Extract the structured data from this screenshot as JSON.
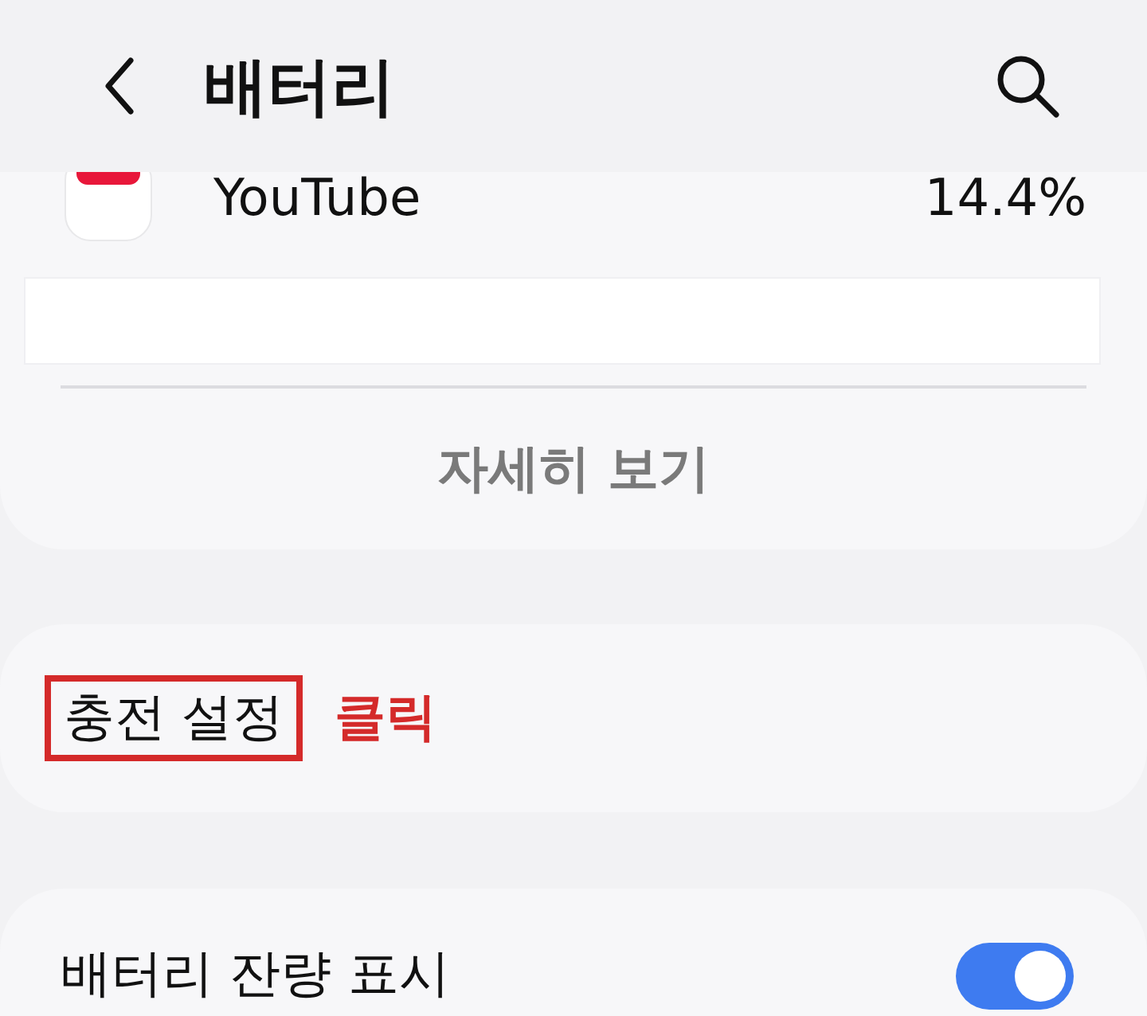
{
  "header": {
    "title": "배터리"
  },
  "app_usage": [
    {
      "name": "YouTube",
      "percent": "14.4%"
    }
  ],
  "details_button": "자세히 보기",
  "settings": [
    {
      "kind": "link",
      "label": "충전 설정",
      "highlighted": true,
      "note": "클릭"
    },
    {
      "kind": "toggle",
      "label": "배터리 잔량 표시",
      "on": true
    }
  ]
}
